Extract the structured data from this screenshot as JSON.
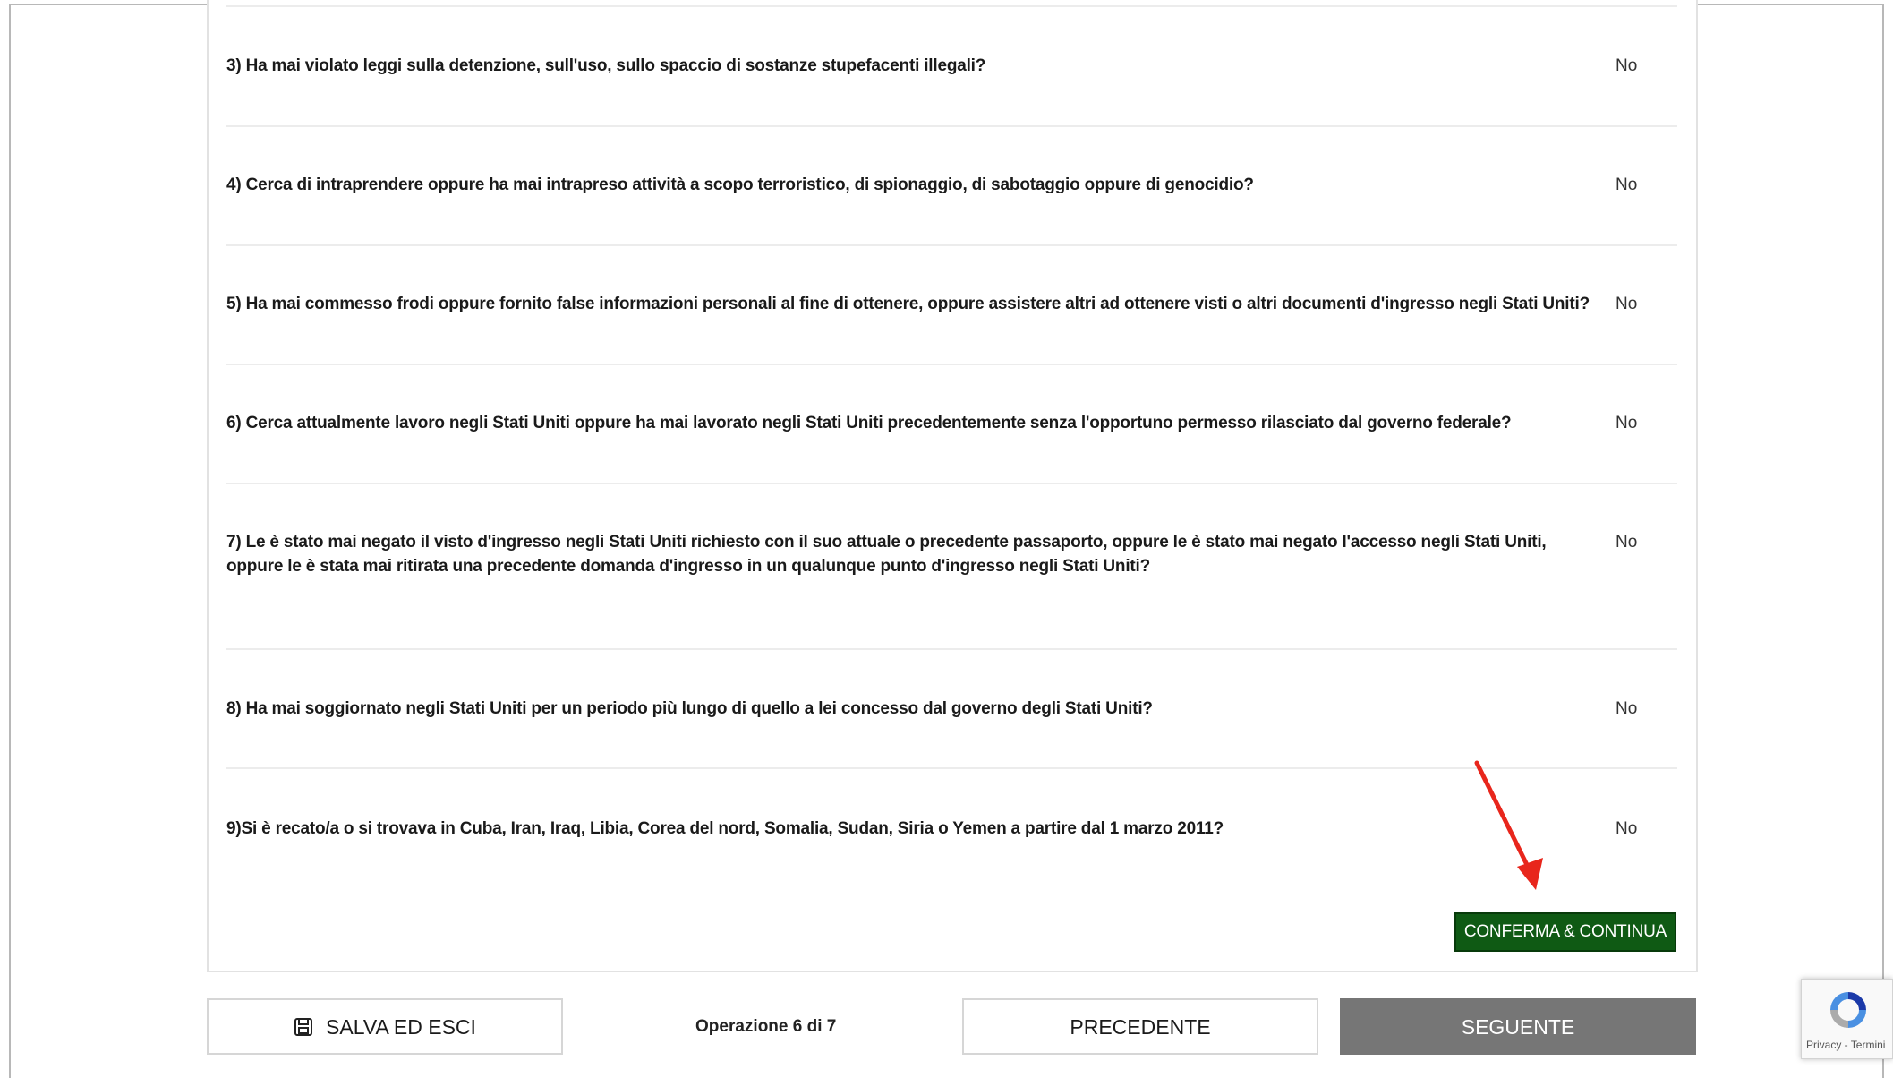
{
  "questions": [
    {
      "text": "3) Ha mai violato leggi sulla detenzione, sull'uso, sullo spaccio di sostanze stupefacenti illegali?",
      "answer": "No"
    },
    {
      "text": "4) Cerca di intraprendere oppure ha mai intrapreso attività a scopo terroristico, di spionaggio, di sabotaggio oppure di genocidio?",
      "answer": "No"
    },
    {
      "text": "5) Ha mai commesso frodi oppure fornito false informazioni personali al fine di ottenere, oppure assistere altri ad ottenere visti o altri documenti d'ingresso negli Stati Uniti?",
      "answer": "No"
    },
    {
      "text": "6) Cerca attualmente lavoro negli Stati Uniti oppure ha mai lavorato negli Stati Uniti precedentemente senza l'opportuno permesso rilasciato dal governo federale?",
      "answer": "No"
    },
    {
      "text": "7) Le è stato mai negato il visto d'ingresso negli Stati Uniti richiesto con il suo attuale o precedente passaporto, oppure le è stato mai negato l'accesso negli Stati Uniti, oppure le è stata mai ritirata una precedente domanda d'ingresso in un qualunque punto d'ingresso negli Stati Uniti?",
      "answer": "No"
    },
    {
      "text": "8) Ha mai soggiornato negli Stati Uniti per un periodo più lungo di quello a lei concesso dal governo degli Stati Uniti?",
      "answer": "No"
    },
    {
      "text": "9)Si è recato/a o si trovava in Cuba, Iran, Iraq, Libia, Corea del nord, Somalia, Sudan, Siria o Yemen a partire dal 1 marzo 2011?",
      "answer": "No"
    }
  ],
  "confirm_button": "CONFERMA & CONTINUA",
  "footer": {
    "save_exit": "SALVA ED ESCI",
    "save_icon": "floppy-disk-icon",
    "step_text": "Operazione 6 di 7",
    "previous": "PRECEDENTE",
    "next": "SEGUENTE"
  },
  "recaptcha": {
    "links": "Privacy - Termini"
  },
  "colors": {
    "confirm_bg": "#0f5a14",
    "next_bg": "#767676",
    "annotation_arrow": "#e8261c"
  }
}
